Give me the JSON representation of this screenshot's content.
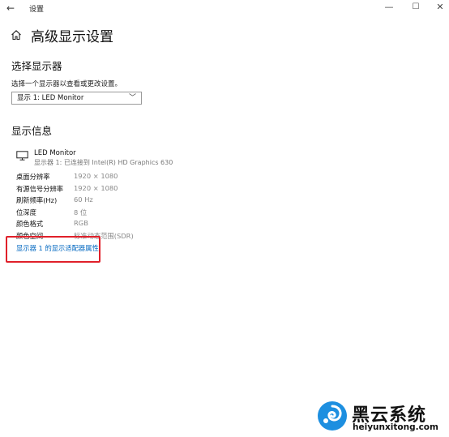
{
  "window": {
    "title": "设置",
    "back_icon": "arrow-left-icon",
    "minimize": "—",
    "maximize": "☐",
    "close": "✕"
  },
  "header": {
    "home_icon": "home-icon",
    "title": "高级显示设置"
  },
  "select_display": {
    "heading": "选择显示器",
    "description": "选择一个显示器以查看或更改设置。",
    "dropdown_value": "显示 1: LED Monitor",
    "dropdown_chevron": "﹀"
  },
  "display_info": {
    "heading": "显示信息",
    "monitor_icon": "monitor-icon",
    "monitor_name": "LED Monitor",
    "monitor_connection": "显示器 1: 已连接到 Intel(R) HD Graphics 630",
    "rows": [
      {
        "label": "桌面分辨率",
        "value": "1920 × 1080"
      },
      {
        "label": "有源信号分辨率",
        "value": "1920 × 1080"
      },
      {
        "label": "刷新频率(Hz)",
        "value": "60 Hz"
      },
      {
        "label": "位深度",
        "value": "8 位"
      },
      {
        "label": "颜色格式",
        "value": "RGB"
      },
      {
        "label": "颜色空间",
        "value": "标准动态范围(SDR)"
      }
    ],
    "adapter_link": "显示器 1 的显示适配器属性"
  },
  "watermark": {
    "brand": "黑云系统",
    "url": "heiyunxitong.com",
    "logo_color": "#1d8fe0"
  },
  "colors": {
    "link": "#0067c0",
    "highlight_box": "#e0202a"
  }
}
